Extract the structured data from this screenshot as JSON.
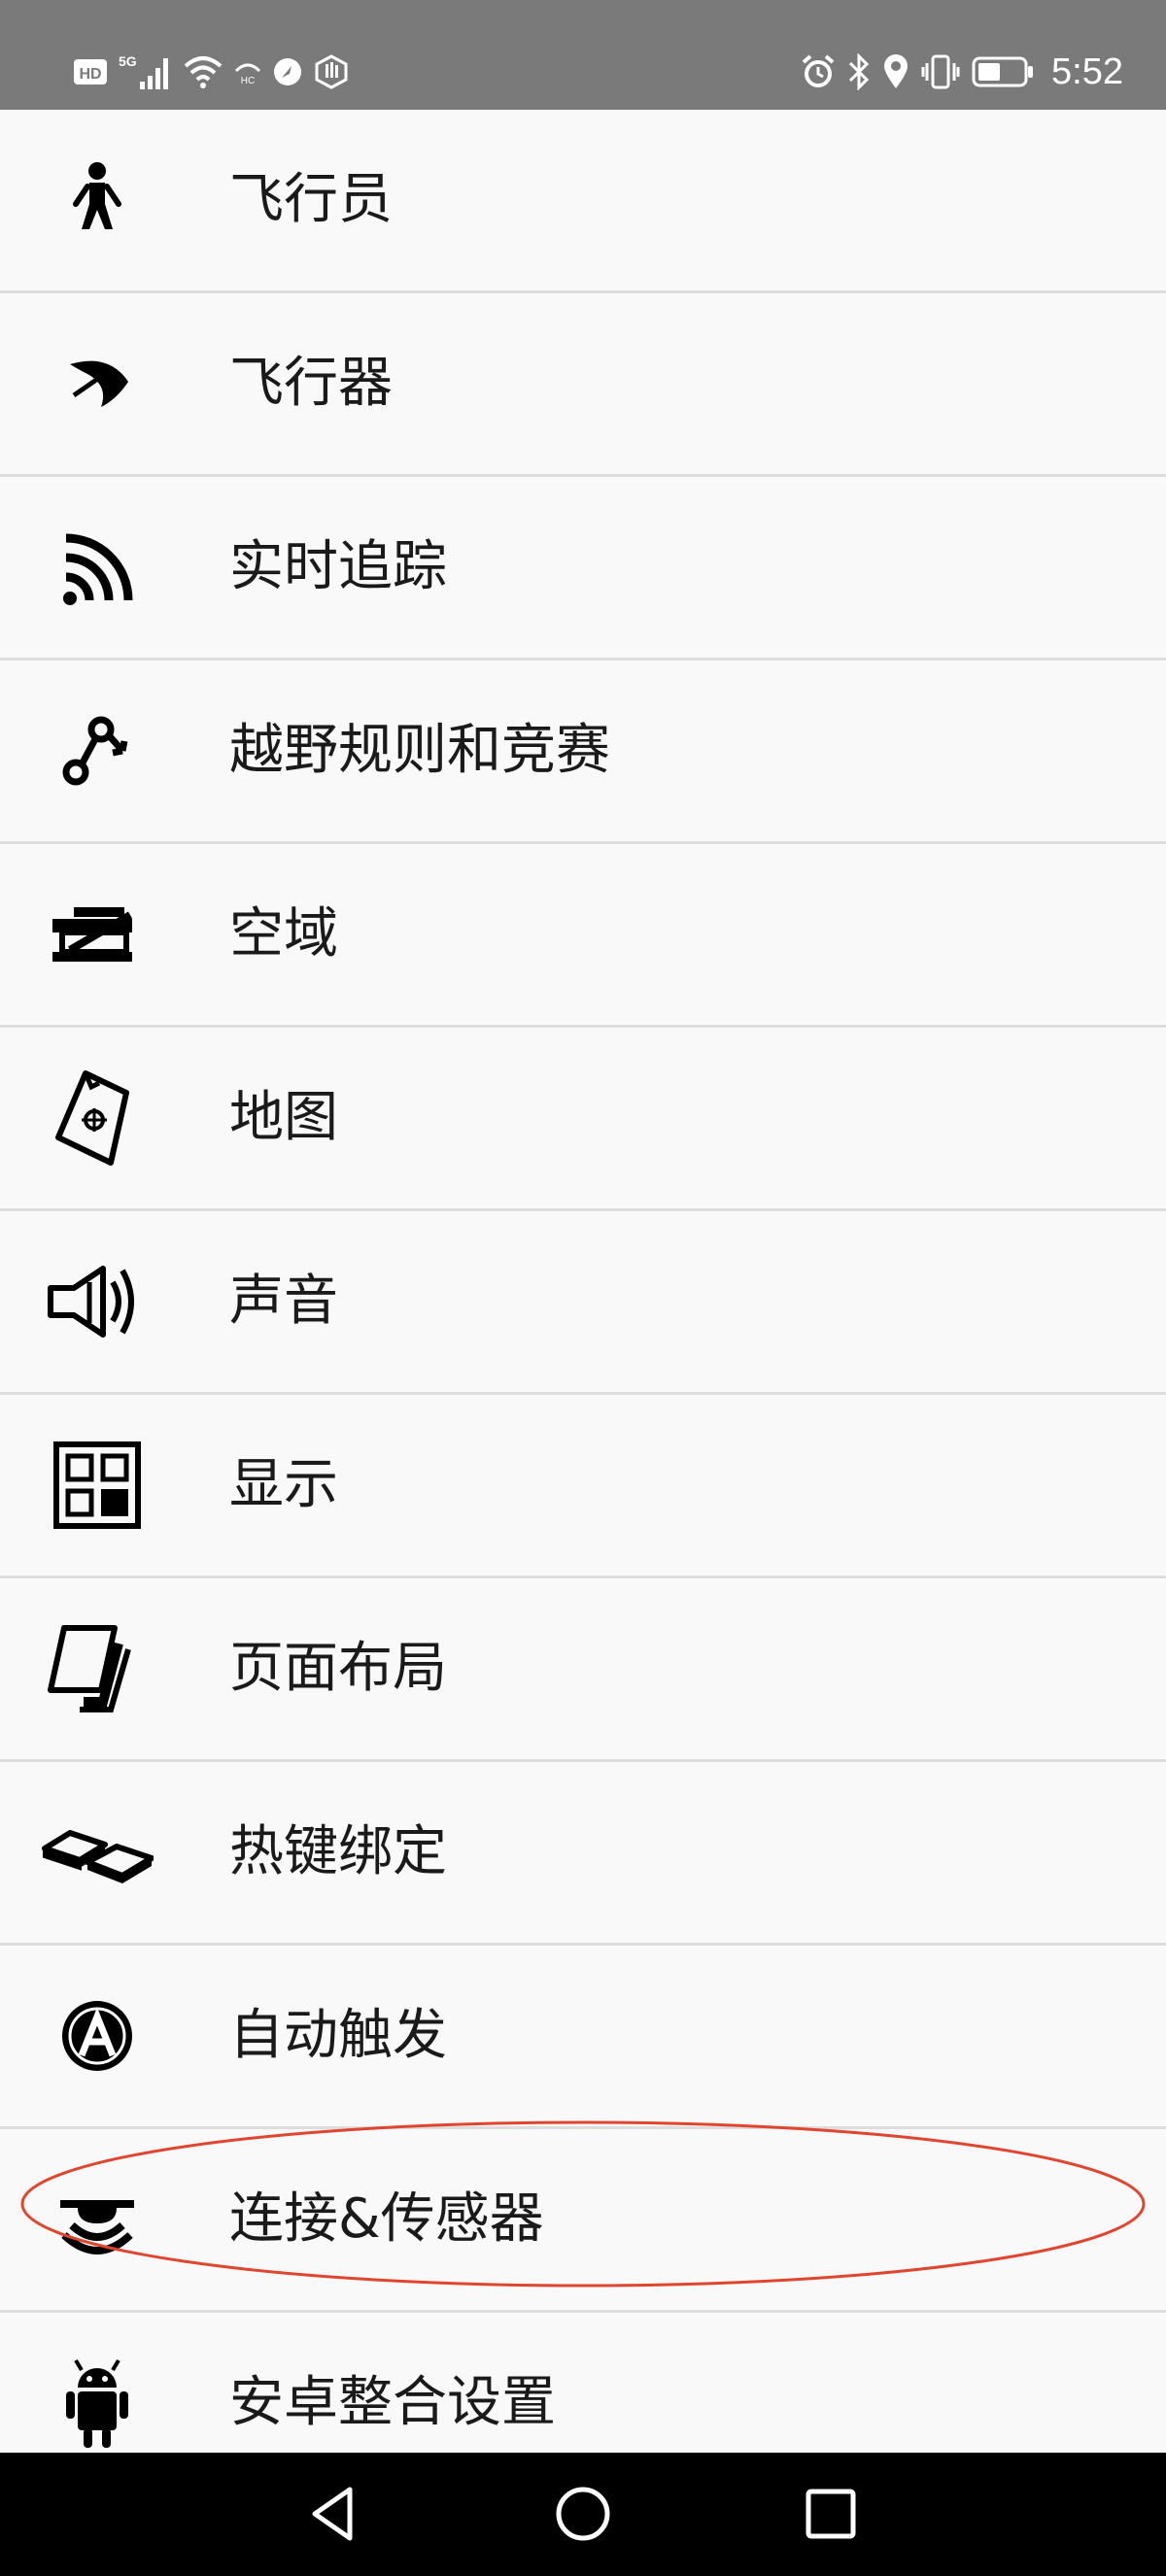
{
  "status_bar": {
    "time": "5:52",
    "left_icons": [
      "hd-icon",
      "5g-signal-icon",
      "wifi-icon",
      "hotspot-icon",
      "browser-icon",
      "hand-icon"
    ],
    "right_icons": [
      "alarm-icon",
      "bluetooth-icon",
      "location-icon",
      "vibrate-icon",
      "battery-icon"
    ],
    "signal_label": "5G",
    "hd_label": "HD"
  },
  "menu": {
    "items": [
      {
        "label": "飞行员",
        "icon": "pilot-icon"
      },
      {
        "label": "飞行器",
        "icon": "glider-icon"
      },
      {
        "label": "实时追踪",
        "icon": "live-tracking-icon"
      },
      {
        "label": "越野规则和竞赛",
        "icon": "route-icon"
      },
      {
        "label": "空域",
        "icon": "airspace-icon"
      },
      {
        "label": "地图",
        "icon": "map-icon"
      },
      {
        "label": "声音",
        "icon": "speaker-icon"
      },
      {
        "label": "显示",
        "icon": "display-grid-icon"
      },
      {
        "label": "页面布局",
        "icon": "pages-icon"
      },
      {
        "label": "热键绑定",
        "icon": "keys-icon"
      },
      {
        "label": "自动触发",
        "icon": "auto-trigger-icon"
      },
      {
        "label": "连接&传感器",
        "icon": "sensor-icon"
      },
      {
        "label": "安卓整合设置",
        "icon": "android-icon"
      }
    ]
  },
  "highlight": {
    "color": "#e0462f",
    "target": "连接&传感器"
  },
  "nav_bar": {
    "buttons": [
      "back-icon",
      "home-icon",
      "recents-icon"
    ]
  }
}
